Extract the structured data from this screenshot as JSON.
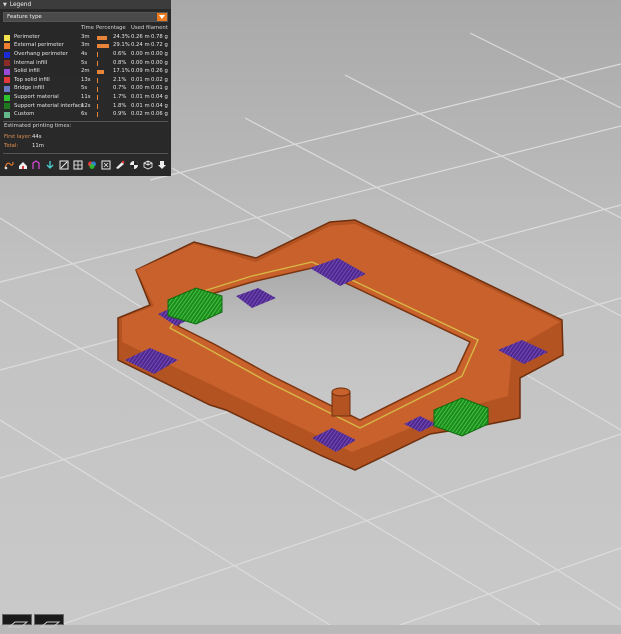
{
  "legend": {
    "title": "Legend",
    "view_type": "Feature type",
    "headers": {
      "time": "Time",
      "percentage": "Percentage",
      "used_filament": "Used filament"
    },
    "rows": [
      {
        "name": "Perimeter",
        "color": "#f4e24c",
        "time": "3m",
        "pct": "24.3%",
        "pct_value": 24.3,
        "length": "0.26 m",
        "weight": "0.78 g"
      },
      {
        "name": "External perimeter",
        "color": "#ee7c31",
        "time": "3m",
        "pct": "29.1%",
        "pct_value": 29.1,
        "length": "0.24 m",
        "weight": "0.72 g"
      },
      {
        "name": "Overhang perimeter",
        "color": "#1a2bd6",
        "time": "4s",
        "pct": "0.6%",
        "pct_value": 0.6,
        "length": "0.00 m",
        "weight": "0.00 g"
      },
      {
        "name": "Internal infill",
        "color": "#8a2a2a",
        "time": "5s",
        "pct": "0.8%",
        "pct_value": 0.8,
        "length": "0.00 m",
        "weight": "0.00 g"
      },
      {
        "name": "Solid infill",
        "color": "#9a4ad6",
        "time": "2m",
        "pct": "17.1%",
        "pct_value": 17.1,
        "length": "0.09 m",
        "weight": "0.26 g"
      },
      {
        "name": "Top solid infill",
        "color": "#e23a3a",
        "time": "13s",
        "pct": "2.1%",
        "pct_value": 2.1,
        "length": "0.01 m",
        "weight": "0.02 g"
      },
      {
        "name": "Bridge infill",
        "color": "#6b78c4",
        "time": "5s",
        "pct": "0.7%",
        "pct_value": 0.7,
        "length": "0.00 m",
        "weight": "0.01 g"
      },
      {
        "name": "Support material",
        "color": "#2ec42e",
        "time": "11s",
        "pct": "1.7%",
        "pct_value": 1.7,
        "length": "0.01 m",
        "weight": "0.04 g"
      },
      {
        "name": "Support material interface",
        "color": "#1f7a1f",
        "time": "12s",
        "pct": "1.8%",
        "pct_value": 1.8,
        "length": "0.01 m",
        "weight": "0.04 g"
      },
      {
        "name": "Custom",
        "color": "#62b88a",
        "time": "6s",
        "pct": "0.9%",
        "pct_value": 0.9,
        "length": "0.02 m",
        "weight": "0.06 g"
      }
    ],
    "estimated_title": "Estimated printing times:",
    "first_layer_label": "First layer:",
    "first_layer_value": "44s",
    "total_label": "Total:",
    "total_value": "11m"
  },
  "toolbar_icons": [
    "travel-icon",
    "wipe-icon",
    "retractions-icon",
    "deretractions-icon",
    "seams-icon",
    "tool-changes-icon",
    "color-changes-icon",
    "pause-prints-icon",
    "custom-gcodes-icon",
    "center-of-gravity-icon",
    "shells-icon",
    "tool-marker-icon"
  ],
  "colors": {
    "accent": "#ea7b20",
    "background": "#b9b9b9",
    "panel": "#202020"
  }
}
